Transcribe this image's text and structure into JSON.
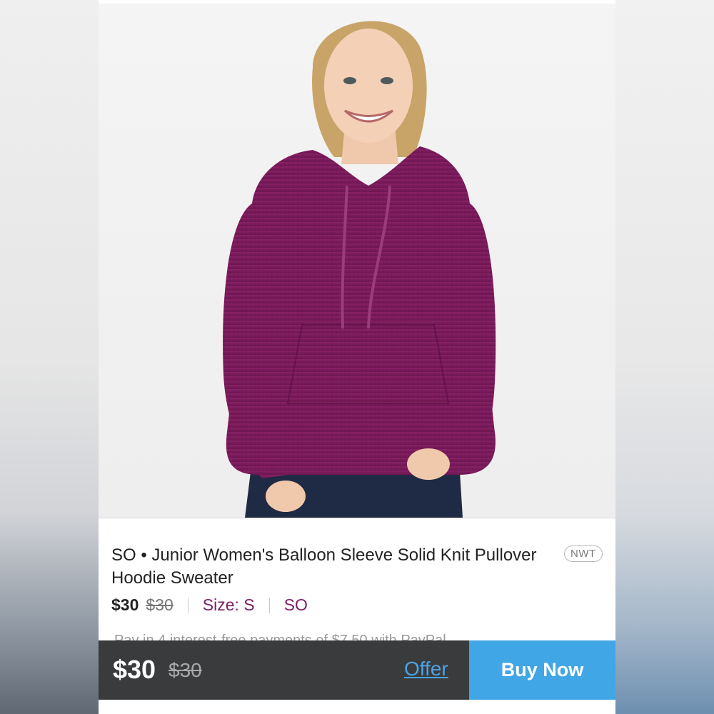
{
  "listing": {
    "brand": "SO",
    "title": "SO • Junior Women's Balloon Sleeve Solid Knit Pullover Hoodie Sweater",
    "condition_badge": "NWT",
    "price": "$30",
    "original_price": "$30",
    "size": "Size: S",
    "brand_link": "SO",
    "teaser_text": "Pay in 4 interest-free payments of $7.50 with PayPal"
  },
  "bottom_bar": {
    "price": "$30",
    "original_price": "$30",
    "offer_label": "Offer",
    "buy_now_label": "Buy Now"
  },
  "colors": {
    "accent_blue": "#41a6e6",
    "offer_link": "#4aa3e6",
    "meta_text": "#7b1e63",
    "sweater": "#7d1c5e",
    "bottom_bar_bg": "#3a3b3c"
  },
  "image": {
    "subject": "product-photo",
    "alt": ""
  }
}
